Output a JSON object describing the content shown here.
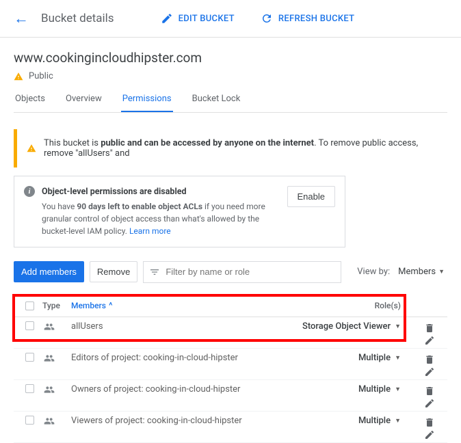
{
  "header": {
    "title": "Bucket details",
    "edit_label": "EDIT BUCKET",
    "refresh_label": "REFRESH BUCKET"
  },
  "bucket": {
    "name": "www.cookingincloudhipster.com",
    "public_label": "Public"
  },
  "tabs": [
    {
      "label": "Objects"
    },
    {
      "label": "Overview"
    },
    {
      "label": "Permissions"
    },
    {
      "label": "Bucket Lock"
    }
  ],
  "banner": {
    "prefix": "This bucket is ",
    "bold": "public and can be accessed by anyone on the internet",
    "suffix": ". To remove public access, remove \"allUsers\" and"
  },
  "info_card": {
    "title": "Object-level permissions are disabled",
    "line1_a": "You have ",
    "line1_bold": "90 days left to enable object ACLs",
    "line1_b": " if you need more granular control of object access than what's allowed by the bucket-level IAM policy. ",
    "link": "Learn more",
    "enable_label": "Enable"
  },
  "controls": {
    "add_label": "Add members",
    "remove_label": "Remove",
    "filter_placeholder": "Filter by name or role",
    "view_by_label": "View by:",
    "view_by_value": "Members"
  },
  "table": {
    "headers": {
      "type": "Type",
      "members": "Members",
      "roles": "Role(s)"
    },
    "rows": [
      {
        "member": "allUsers",
        "role": "Storage Object Viewer"
      },
      {
        "member": "Editors of project: cooking-in-cloud-hipster",
        "role": "Multiple"
      },
      {
        "member": "Owners of project: cooking-in-cloud-hipster",
        "role": "Multiple"
      },
      {
        "member": "Viewers of project: cooking-in-cloud-hipster",
        "role": "Multiple"
      }
    ]
  }
}
